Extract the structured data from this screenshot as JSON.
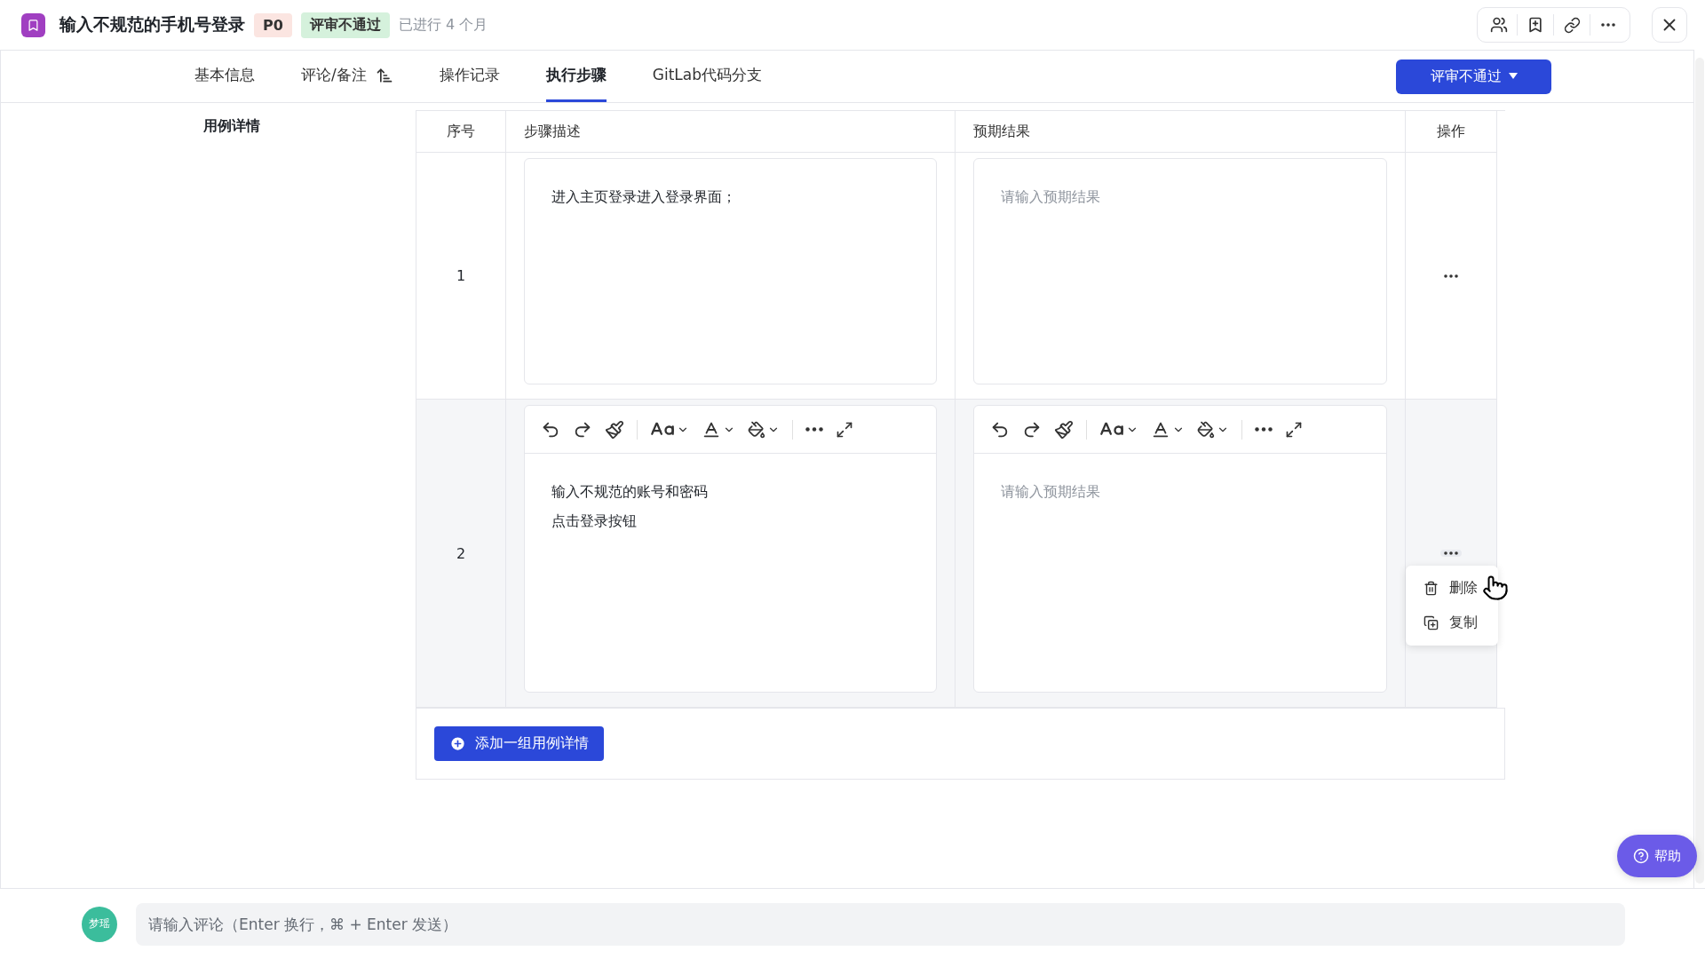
{
  "header": {
    "title": "输入不规范的手机号登录",
    "priority": "P0",
    "status": "评审不通过",
    "elapsed": "已进行 4 个月"
  },
  "tabs": [
    {
      "label": "基本信息",
      "selected": false,
      "kind": "plain"
    },
    {
      "label": "评论/备注",
      "selected": false,
      "kind": "sort"
    },
    {
      "label": "操作记录",
      "selected": false,
      "kind": "plain"
    },
    {
      "label": "执行步骤",
      "selected": true,
      "kind": "plain"
    },
    {
      "label": "GitLab代码分支",
      "selected": false,
      "kind": "plain"
    }
  ],
  "action_button": {
    "label": "评审不通过"
  },
  "section_label": "用例详情",
  "table": {
    "columns": [
      "序号",
      "步骤描述",
      "预期结果",
      "操作"
    ],
    "rows": [
      {
        "index": "1",
        "step": [
          "进入主页登录进入登录界面；"
        ],
        "expected_placeholder": "请输入预期结果",
        "editing": false,
        "menu_open": false
      },
      {
        "index": "2",
        "step": [
          "输入不规范的账号和密码",
          "点击登录按钮"
        ],
        "expected_placeholder": "请输入预期结果",
        "editing": true,
        "menu_open": true
      }
    ]
  },
  "row_menu": [
    {
      "kind": "delete",
      "label": "删除"
    },
    {
      "kind": "copy",
      "label": "复制"
    }
  ],
  "add_button": "添加一组用例详情",
  "help_button": "帮助",
  "comment": {
    "avatar": "梦瑶",
    "placeholder": "请输入评论（Enter 换行，⌘ + Enter 发送）"
  }
}
